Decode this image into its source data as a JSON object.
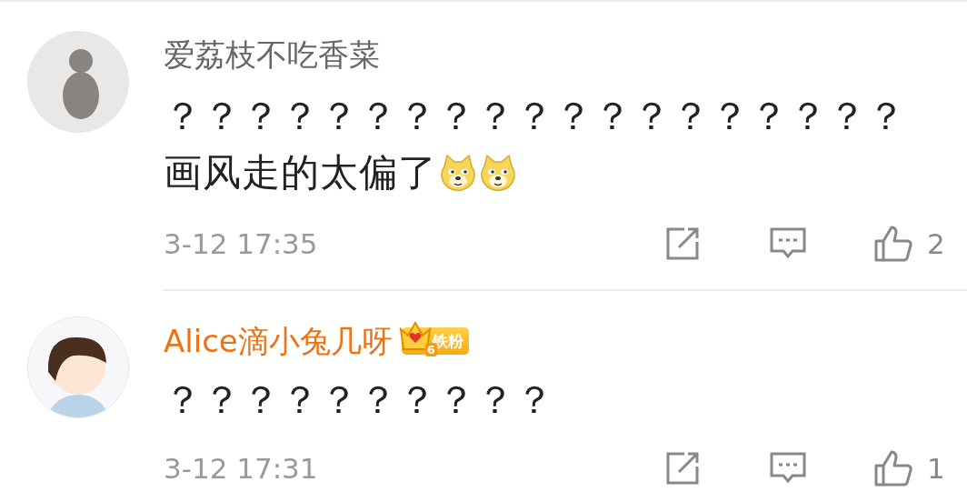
{
  "comments": [
    {
      "user": {
        "name": "爱荔枝不吃香菜",
        "vip": false,
        "avatar": {
          "kind": "photo"
        }
      },
      "lines": [
        {
          "text": "？？？？？？？？？？？？？？？？？？？"
        },
        {
          "text": "画风走的太偏了",
          "emojis": [
            {
              "kind": "doge"
            },
            {
              "kind": "doge"
            }
          ]
        }
      ],
      "time": "3-12 17:35",
      "likes": "2"
    },
    {
      "user": {
        "name": "Alice滴小兔几呀",
        "vip": true,
        "avatar": {
          "kind": "cartoon"
        },
        "badge": {
          "level": "6",
          "label": "铁粉"
        }
      },
      "lines": [
        {
          "text": "？？？？？？？？？？"
        }
      ],
      "time": "3-12 17:31",
      "likes": "1"
    }
  ]
}
